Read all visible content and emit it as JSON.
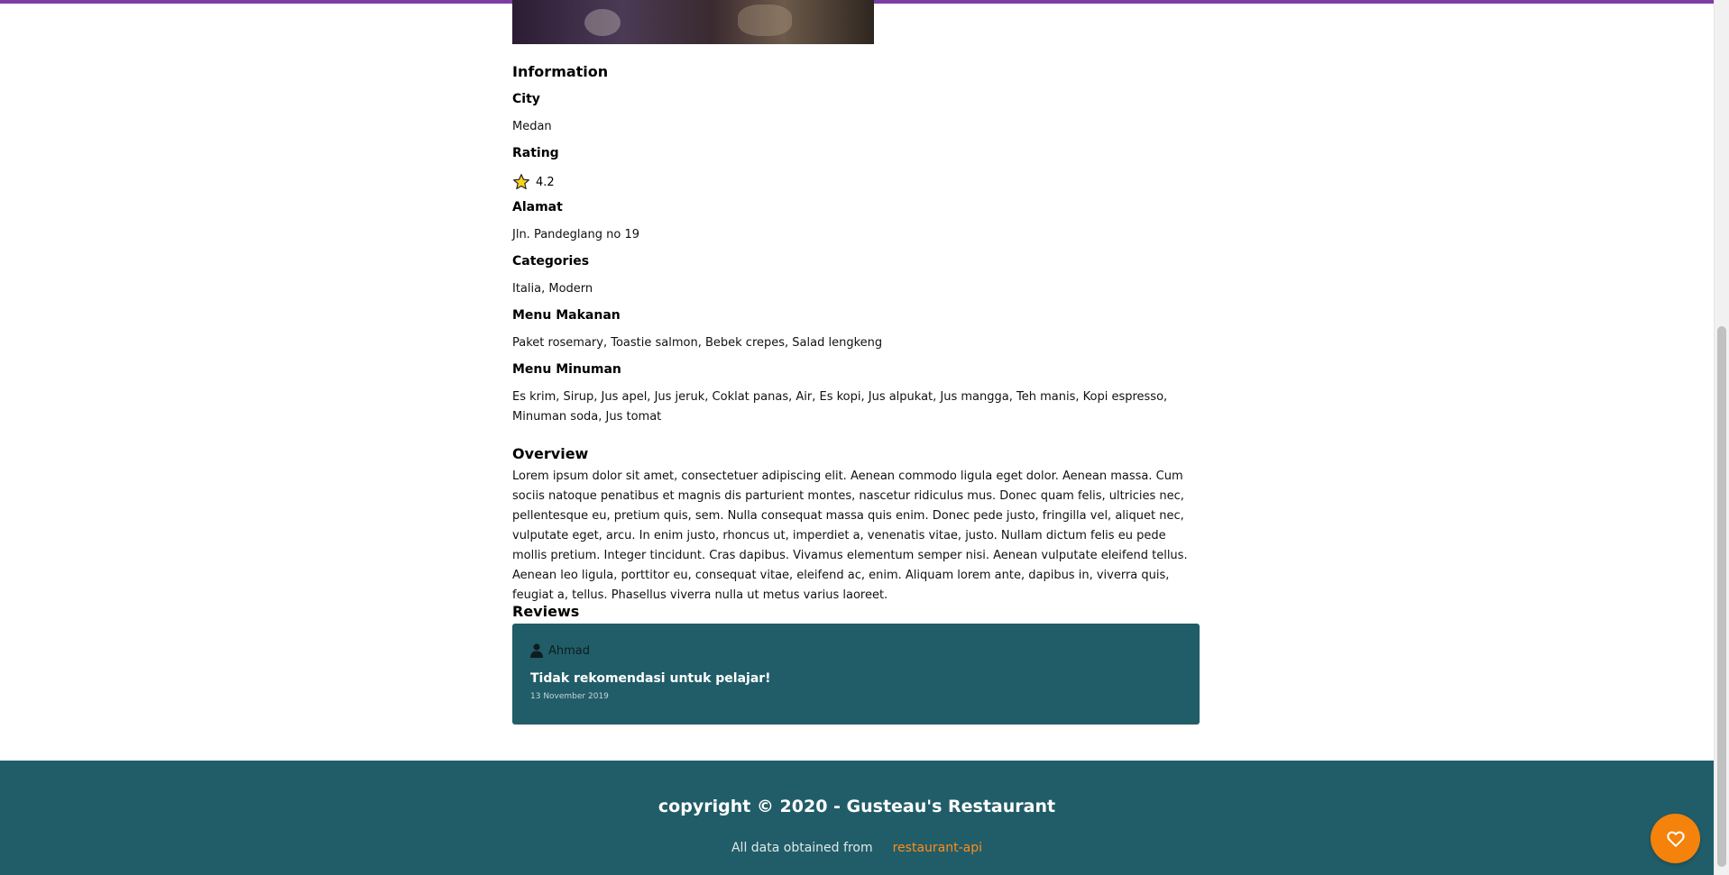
{
  "detail": {
    "information_title": "Information",
    "city_label": "City",
    "city": "Medan",
    "rating_label": "Rating",
    "rating": "4.2",
    "address_label": "Alamat",
    "address": "Jln. Pandeglang no 19",
    "categories_label": "Categories",
    "categories": "Italia, Modern",
    "foods_label": "Menu Makanan",
    "foods": "Paket rosemary, Toastie salmon, Bebek crepes, Salad lengkeng",
    "drinks_label": "Menu Minuman",
    "drinks": "Es krim, Sirup, Jus apel, Jus jeruk, Coklat panas, Air, Es kopi, Jus alpukat, Jus mangga, Teh manis, Kopi espresso, Minuman soda, Jus tomat",
    "overview_title": "Overview",
    "overview": "Lorem ipsum dolor sit amet, consectetuer adipiscing elit. Aenean commodo ligula eget dolor. Aenean massa. Cum sociis natoque penatibus et magnis dis parturient montes, nascetur ridiculus mus. Donec quam felis, ultricies nec, pellentesque eu, pretium quis, sem. Nulla consequat massa quis enim. Donec pede justo, fringilla vel, aliquet nec, vulputate eget, arcu. In enim justo, rhoncus ut, imperdiet a, venenatis vitae, justo. Nullam dictum felis eu pede mollis pretium. Integer tincidunt. Cras dapibus. Vivamus elementum semper nisi. Aenean vulputate eleifend tellus. Aenean leo ligula, porttitor eu, consequat vitae, eleifend ac, enim. Aliquam lorem ante, dapibus in, viverra quis, feugiat a, tellus. Phasellus viverra nulla ut metus varius laoreet.",
    "reviews_title": "Reviews"
  },
  "reviews": [
    {
      "name": "Ahmad",
      "review": "Tidak rekomendasi untuk pelajar!",
      "date": "13 November 2019"
    }
  ],
  "footer": {
    "copyright": "copyright © 2020 - Gusteau's Restaurant",
    "source_prefix": "All data obtained from",
    "source_link": "restaurant-api"
  },
  "colors": {
    "accent": "#215d68",
    "fab": "#f5820b",
    "topbar": "#7b3fa3"
  },
  "icons": {
    "rating": "star-icon",
    "reviewer": "user-icon",
    "favorite": "heart-icon"
  }
}
